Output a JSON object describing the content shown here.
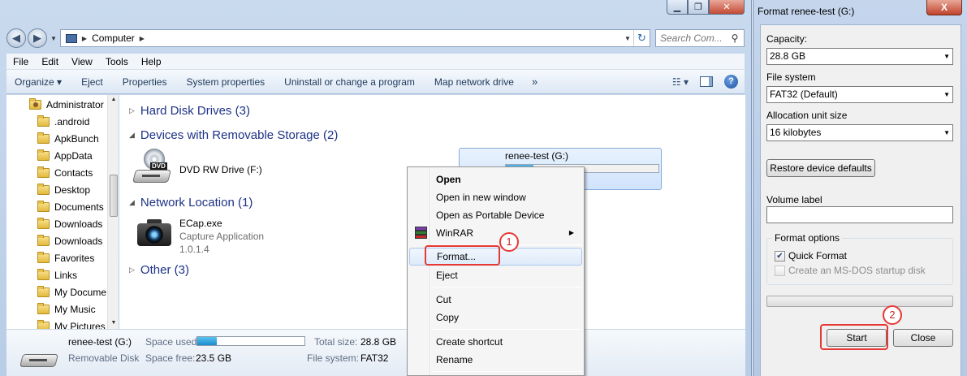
{
  "explorer": {
    "breadcrumb": "Computer",
    "search_placeholder": "Search Com...",
    "menu": [
      "File",
      "Edit",
      "View",
      "Tools",
      "Help"
    ],
    "toolbar": [
      "Organize ▾",
      "Eject",
      "Properties",
      "System properties",
      "Uninstall or change a program",
      "Map network drive"
    ],
    "toolbar_more": "»",
    "tree": [
      "Administrator",
      ".android",
      "ApkBunch",
      "AppData",
      "Contacts",
      "Desktop",
      "Documents",
      "Downloads",
      "Downloads",
      "Favorites",
      "Links",
      "My Docume",
      "My Music",
      "My Pictures"
    ],
    "groups": {
      "hdd": "Hard Disk Drives (3)",
      "removable": "Devices with Removable Storage (2)",
      "network": "Network Location (1)",
      "other": "Other (3)"
    },
    "dvd": {
      "name": "DVD RW Drive (F:)",
      "badge": "DVD"
    },
    "usb": {
      "name": "renee-test (G:)",
      "free_partial": "23.5 G",
      "used_fraction": 0.18
    },
    "network_item": {
      "name": "ECap.exe",
      "desc": "Capture Application",
      "version": "1.0.1.4"
    },
    "details": {
      "name": "renee-test (G:)",
      "type": "Removable Disk",
      "space_used_label": "Space used:",
      "space_free_label": "Space free:",
      "space_free": "23.5 GB",
      "total_size_label": "Total size:",
      "total_size": "28.8 GB",
      "file_system_label": "File system:",
      "file_system": "FAT32",
      "used_fraction": 0.18
    }
  },
  "context_menu": {
    "items": [
      "Open",
      "Open in new window",
      "Open as Portable Device",
      "WinRAR",
      "Format...",
      "Eject",
      "Cut",
      "Copy",
      "Create shortcut",
      "Rename"
    ]
  },
  "format_dialog": {
    "title": "Format renee-test (G:)",
    "close": "X",
    "capacity_label": "Capacity:",
    "capacity": "28.8 GB",
    "fs_label": "File system",
    "fs": "FAT32 (Default)",
    "alloc_label": "Allocation unit size",
    "alloc": "16 kilobytes",
    "restore": "Restore device defaults",
    "volume_label": "Volume label",
    "volume_value": "",
    "options_label": "Format options",
    "quick_format": "Quick Format",
    "msdos": "Create an MS-DOS startup disk",
    "start": "Start",
    "close_btn": "Close"
  },
  "annotations": {
    "step1": "1",
    "step2": "2"
  },
  "colors": {
    "annotation": "#e53935",
    "group_header": "#1e3287",
    "capacity_fill": "#1d89c8"
  }
}
